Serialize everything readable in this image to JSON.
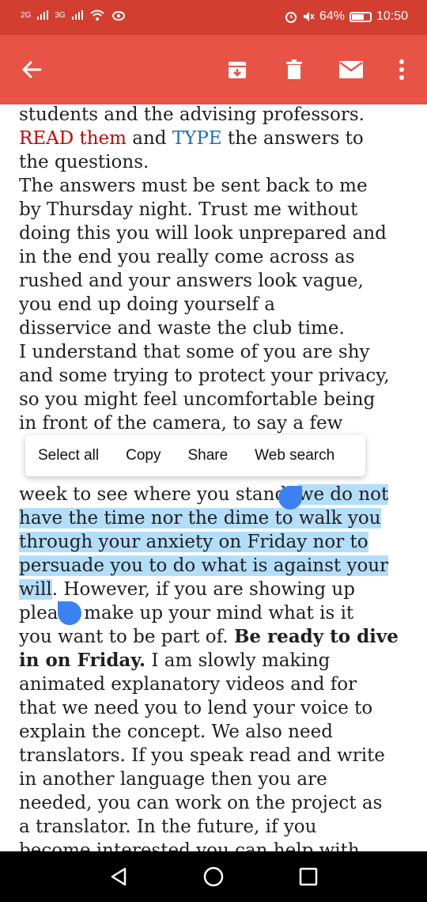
{
  "status": {
    "network_1": "2G",
    "network_2": "3G",
    "battery": "64%",
    "time": "10:50"
  },
  "toolbar": {
    "back_icon": "arrow-left-icon",
    "archive_icon": "archive-icon",
    "delete_icon": "trash-icon",
    "mail_icon": "mail-icon",
    "more_icon": "more-vertical-icon"
  },
  "email": {
    "line1": "students and the advising professors.",
    "line2a": "READ them",
    "line2b": " and ",
    "line2c": "TYPE",
    "line2d": " the answers to",
    "line3": "the questions.",
    "line4": "The answers must be sent back to me",
    "line5": "by Thursday night.  Trust me without",
    "line6": "doing this you will look unprepared and",
    "line7": "in the end you really come across as",
    "line8": "rushed and your answers look vague,",
    "line9": "you end up doing yourself a",
    "line10": "disservice and waste the club time.",
    "line11": "I understand that some of you are shy",
    "line12": "and some trying to protect your privacy,",
    "line13": "so you might feel uncomfortable being",
    "line14": "in front of the camera, to say a few",
    "line17a": "week to see where you stand, ",
    "line17b": "we do not",
    "line18": "have the time nor the dime to walk you",
    "line19": "through your anxiety on Friday nor to",
    "line20": "persuade you to do what is against your",
    "line21a": "will",
    "line21b": ". However, if you are showing up",
    "line22": "please make up your mind what is it",
    "line23a": "you want to be part of. ",
    "line23b": "Be ready to dive",
    "line24a": "in on Friday.",
    "line24b": " I am slowly making",
    "line25": "animated explanatory videos and for",
    "line26": "that we need you to lend your voice to",
    "line27": "explain the concept. We also need",
    "line28": "translators. If you speak read and write",
    "line29": "in another language then you are",
    "line30": "needed, you can work on the project as",
    "line31": "a translator. In the future, if you",
    "line32": "become interested you can help with"
  },
  "popup": {
    "select_all": "Select all",
    "copy": "Copy",
    "share": "Share",
    "web_search": "Web search"
  },
  "nav": {
    "back_icon": "triangle-back-icon",
    "home_icon": "circle-home-icon",
    "recents_icon": "square-recents-icon"
  }
}
